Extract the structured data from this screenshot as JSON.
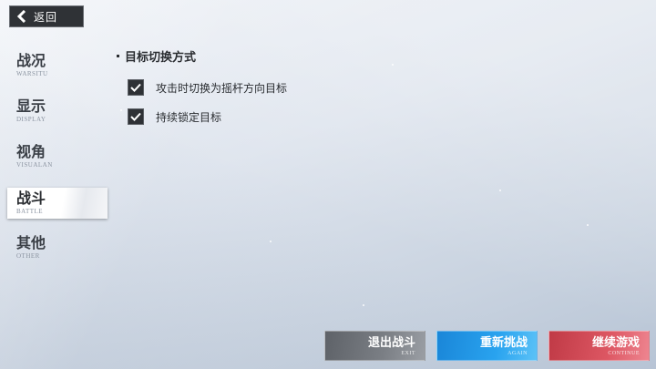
{
  "back": {
    "label": "返回",
    "icon": "chevron-left-icon"
  },
  "sidebar": {
    "items": [
      {
        "zh": "战况",
        "en": "WARSITU"
      },
      {
        "zh": "显示",
        "en": "DISPLAY"
      },
      {
        "zh": "视角",
        "en": "VISUALAN"
      },
      {
        "zh": "战斗",
        "en": "BATTLE",
        "active": true
      },
      {
        "zh": "其他",
        "en": "OTHER"
      }
    ]
  },
  "section": {
    "title": "目标切换方式",
    "options": [
      {
        "label": "攻击时切换为摇杆方向目标",
        "checked": true
      },
      {
        "label": "持续锁定目标",
        "checked": true
      }
    ]
  },
  "buttons": {
    "exit": {
      "zh": "退出战斗",
      "en": "EXIT"
    },
    "retry": {
      "zh": "重新挑战",
      "en": "AGAIN"
    },
    "continue": {
      "zh": "继续游戏",
      "en": "CONTINUE"
    }
  },
  "colors": {
    "exit": "#7b7f85",
    "retry": "#29a3ef",
    "continue": "#dd5763",
    "dark": "#2f3236"
  }
}
